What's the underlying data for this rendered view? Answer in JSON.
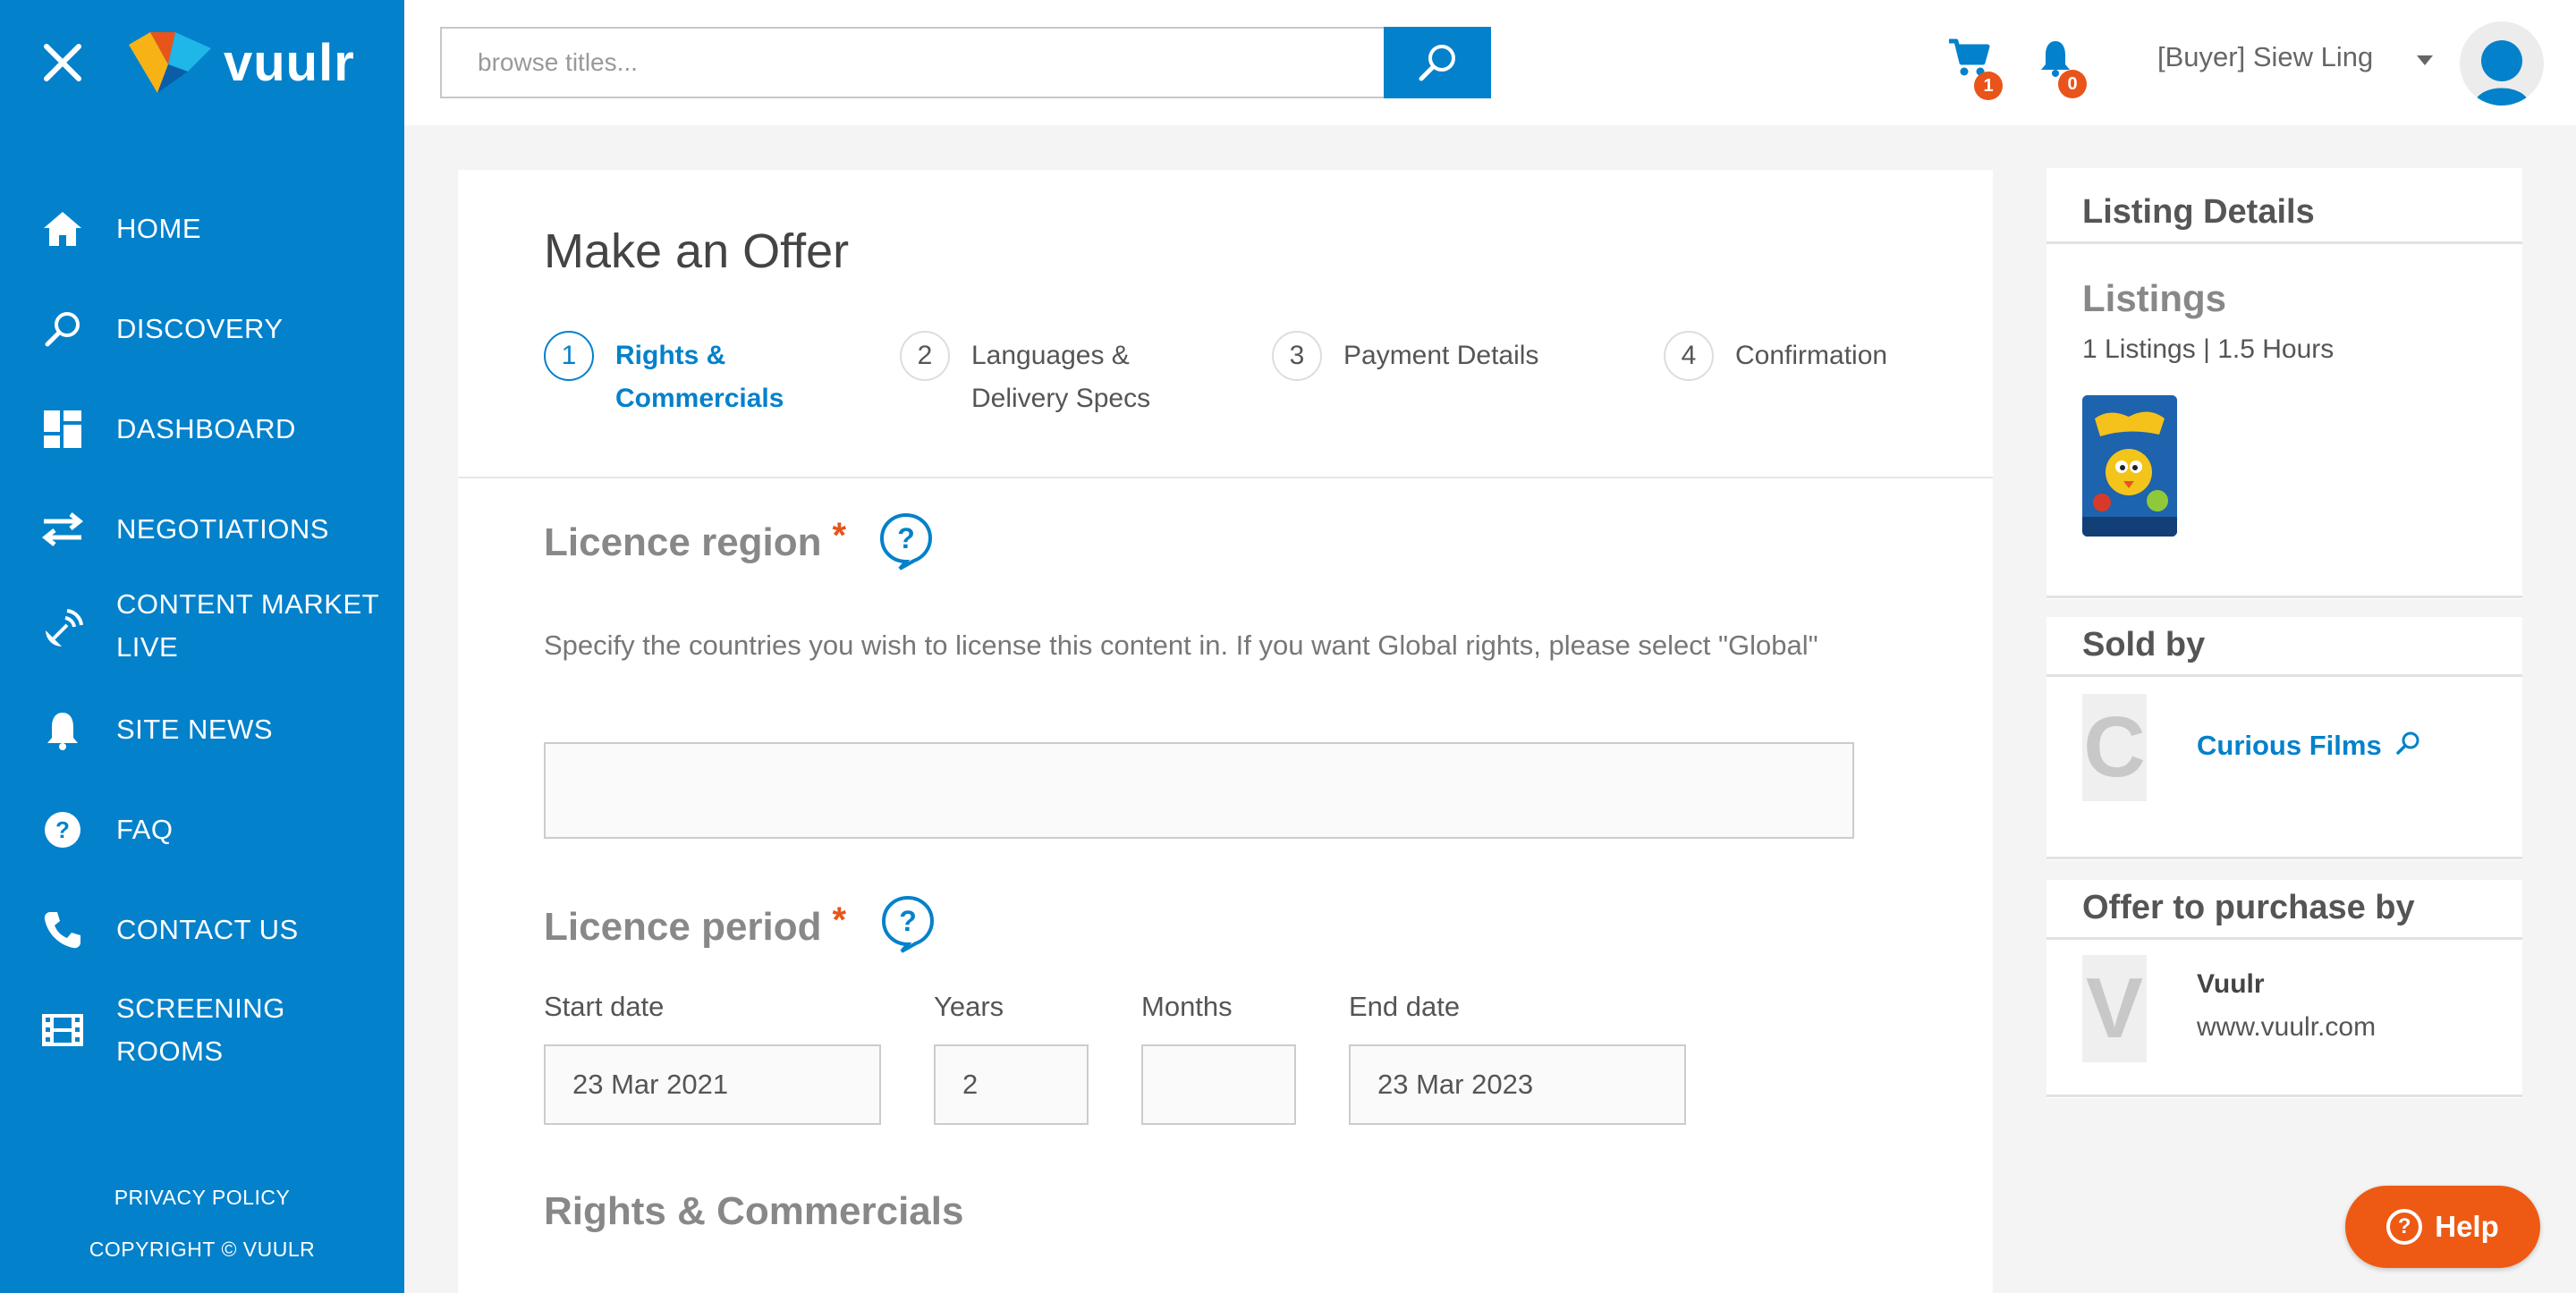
{
  "sidebar": {
    "logo_text": "vuulr",
    "nav": [
      {
        "label": "HOME",
        "icon": "home-icon"
      },
      {
        "label": "DISCOVERY",
        "icon": "search-icon"
      },
      {
        "label": "DASHBOARD",
        "icon": "dashboard-icon"
      },
      {
        "label": "NEGOTIATIONS",
        "icon": "swap-arrows-icon"
      },
      {
        "label": "CONTENT MARKET LIVE",
        "icon": "satellite-icon"
      },
      {
        "label": "SITE NEWS",
        "icon": "bell-icon"
      },
      {
        "label": "FAQ",
        "icon": "question-icon"
      },
      {
        "label": "CONTACT US",
        "icon": "phone-icon"
      },
      {
        "label": "SCREENING ROOMS",
        "icon": "film-icon"
      }
    ],
    "privacy": "PRIVACY POLICY",
    "copyright": "COPYRIGHT © VUULR"
  },
  "header": {
    "search_placeholder": "browse titles...",
    "cart_count": "1",
    "notif_count": "0",
    "user": "[Buyer] Siew Ling"
  },
  "main": {
    "title": "Make an Offer",
    "steps": [
      {
        "num": "1",
        "label": "Rights & Commercials",
        "active": true
      },
      {
        "num": "2",
        "label": "Languages & Delivery Specs",
        "active": false
      },
      {
        "num": "3",
        "label": "Payment Details",
        "active": false
      },
      {
        "num": "4",
        "label": "Confirmation",
        "active": false
      }
    ],
    "region": {
      "heading": "Licence region",
      "required": "*",
      "description": "Specify the countries you wish to license this content in. If you want Global rights, please select \"Global\"",
      "value": ""
    },
    "period": {
      "heading": "Licence period",
      "required": "*",
      "start_label": "Start date",
      "start_value": "23 Mar 2021",
      "years_label": "Years",
      "years_value": "2",
      "months_label": "Months",
      "months_value": "",
      "end_label": "End date",
      "end_value": "23 Mar 2023"
    },
    "rights_heading": "Rights & Commercials"
  },
  "panel": {
    "listing_details": "Listing Details",
    "listings_title": "Listings",
    "listings_sub": "1 Listings | 1.5 Hours",
    "sold_by": "Sold by",
    "seller_initial": "C",
    "seller_name": "Curious Films",
    "offer_by": "Offer to purchase by",
    "buyer_initial": "V",
    "buyer_name": "Vuulr",
    "buyer_site": "www.vuulr.com"
  },
  "help": "Help",
  "colors": {
    "brand_blue": "#0481cb",
    "accent_orange": "#ee5a14"
  }
}
